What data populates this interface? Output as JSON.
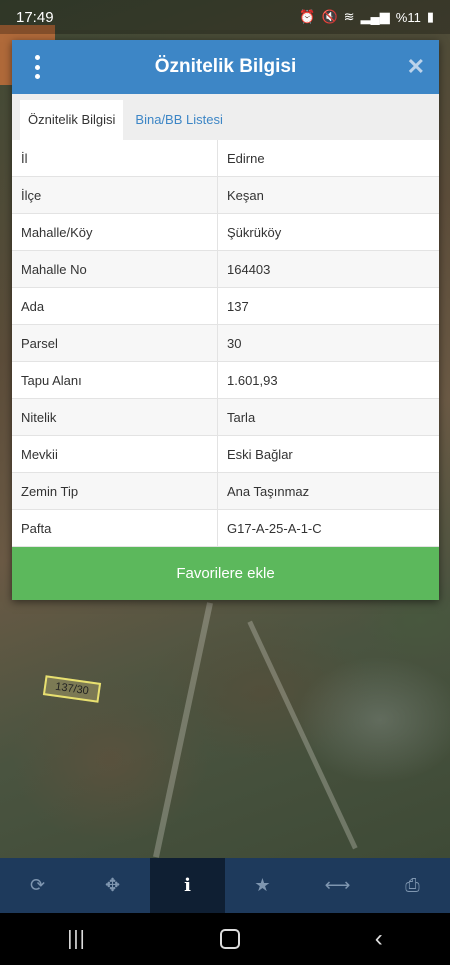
{
  "status_bar": {
    "time": "17:49",
    "battery": "%11"
  },
  "map": {
    "parcel_label": "137/30"
  },
  "dialog": {
    "title": "Öznitelik Bilgisi",
    "tabs": [
      {
        "label": "Öznitelik Bilgisi",
        "active": true
      },
      {
        "label": "Bina/BB Listesi",
        "active": false
      }
    ],
    "rows": [
      {
        "key": "İl",
        "value": "Edirne"
      },
      {
        "key": "İlçe",
        "value": "Keşan"
      },
      {
        "key": "Mahalle/Köy",
        "value": "Şükrüköy"
      },
      {
        "key": "Mahalle No",
        "value": "164403"
      },
      {
        "key": "Ada",
        "value": "137"
      },
      {
        "key": "Parsel",
        "value": "30"
      },
      {
        "key": "Tapu Alanı",
        "value": "1.601,93"
      },
      {
        "key": "Nitelik",
        "value": "Tarla"
      },
      {
        "key": "Mevkii",
        "value": "Eski Bağlar"
      },
      {
        "key": "Zemin Tip",
        "value": "Ana Taşınmaz"
      },
      {
        "key": "Pafta",
        "value": "G17-A-25-A-1-C"
      }
    ],
    "favorite_button": "Favorilere ekle"
  },
  "toolbar": {
    "items": [
      {
        "icon": "refresh-icon",
        "active": false
      },
      {
        "icon": "move-icon",
        "active": false
      },
      {
        "icon": "info-icon",
        "active": true
      },
      {
        "icon": "star-icon",
        "active": false
      },
      {
        "icon": "measure-icon",
        "active": false
      },
      {
        "icon": "print-icon",
        "active": false
      }
    ]
  },
  "colors": {
    "header": "#3d86c6",
    "favorite": "#5cb85c",
    "toolbar": "#1e3a5c"
  }
}
